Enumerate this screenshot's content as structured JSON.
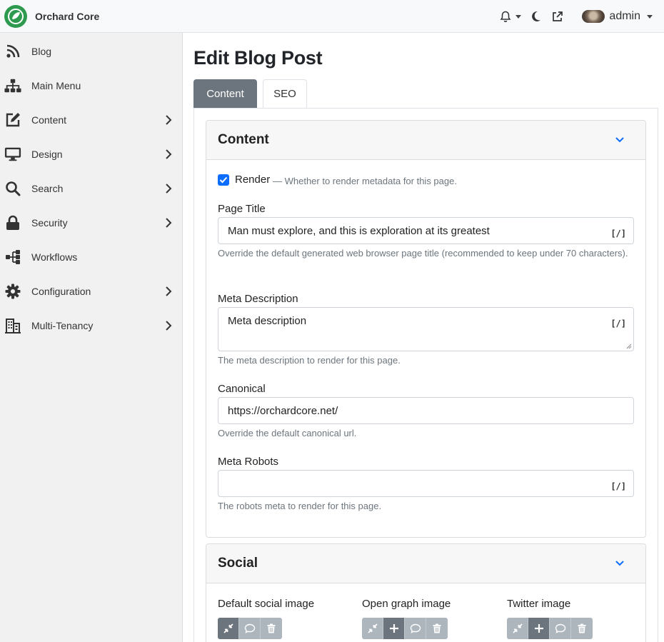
{
  "header": {
    "brand_name": "Orchard Core",
    "user_name": "admin"
  },
  "sidebar": {
    "items": [
      {
        "label": "Blog",
        "icon": "rss-icon",
        "has_submenu": false
      },
      {
        "label": "Main Menu",
        "icon": "sitemap-icon",
        "has_submenu": false
      },
      {
        "label": "Content",
        "icon": "edit-icon",
        "has_submenu": true
      },
      {
        "label": "Design",
        "icon": "desktop-icon",
        "has_submenu": true
      },
      {
        "label": "Search",
        "icon": "search-icon",
        "has_submenu": true
      },
      {
        "label": "Security",
        "icon": "lock-icon",
        "has_submenu": true
      },
      {
        "label": "Workflows",
        "icon": "workflow-icon",
        "has_submenu": false
      },
      {
        "label": "Configuration",
        "icon": "cog-icon",
        "has_submenu": true
      },
      {
        "label": "Multi-Tenancy",
        "icon": "building-icon",
        "has_submenu": true
      }
    ]
  },
  "main": {
    "page_title": "Edit Blog Post",
    "tabs": [
      {
        "label": "Content",
        "active": false
      },
      {
        "label": "SEO",
        "active": true
      }
    ],
    "content_card": {
      "title": "Content",
      "render_label": "Render",
      "render_hint": "— Whether to render metadata for this page.",
      "render_checked": true,
      "page_title_label": "Page Title",
      "page_title_value": "Man must explore, and this is exploration at its greatest",
      "page_title_help": "Override the default generated web browser page title (recommended to keep under 70 characters).",
      "meta_description_label": "Meta Description",
      "meta_description_value": "Meta description",
      "meta_description_help": "The meta description to render for this page.",
      "canonical_label": "Canonical",
      "canonical_value": "https://orchardcore.net/",
      "canonical_help": "Override the default canonical url.",
      "meta_robots_label": "Meta Robots",
      "meta_robots_value": "",
      "meta_robots_help": "The robots meta to render for this page.",
      "liquid_button": "[/]"
    },
    "social_card": {
      "title": "Social",
      "default_image_label": "Default social image",
      "open_graph_image_label": "Open graph image",
      "twitter_image_label": "Twitter image"
    }
  },
  "colors": {
    "brand": "#2d9a4f",
    "primary": "#0d6efd",
    "tab_active_bg": "#6c757d",
    "muted_text": "#6c757d"
  }
}
